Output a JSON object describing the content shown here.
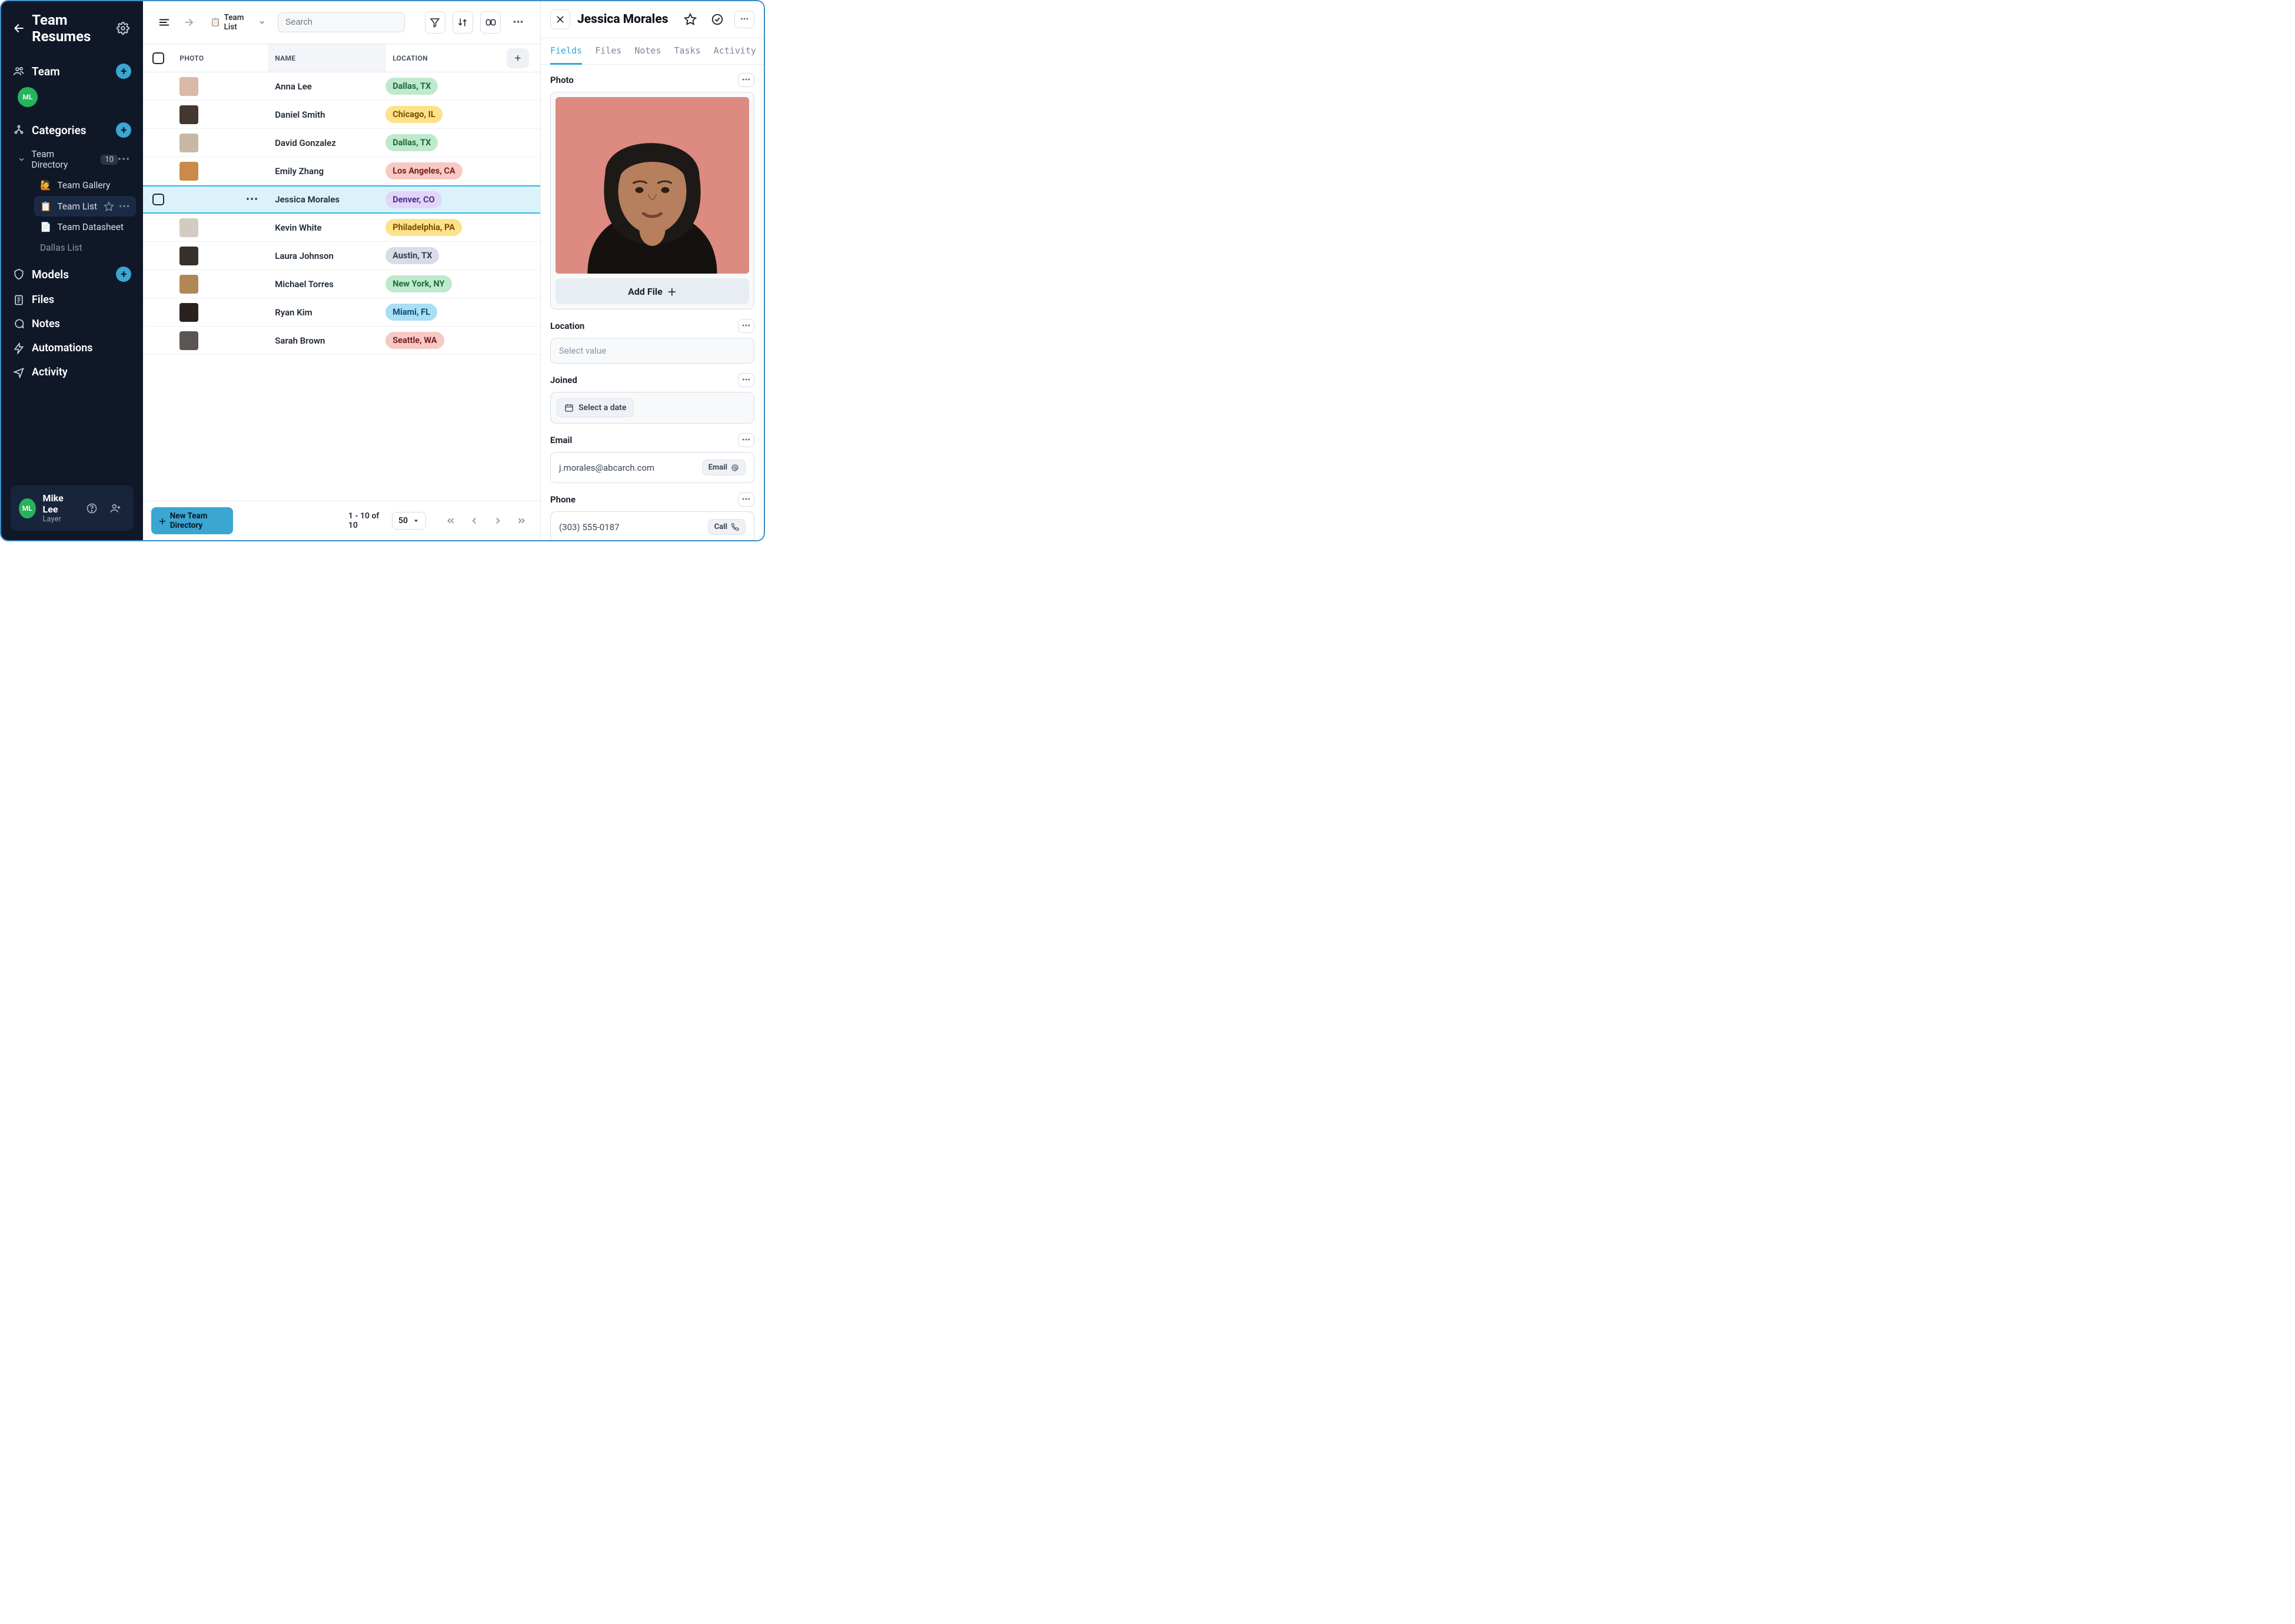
{
  "sidebar": {
    "title": "Team Resumes",
    "team_label": "Team",
    "team_avatar_initials": "ML",
    "team_avatar_color": "#26b35a",
    "categories_label": "Categories",
    "category": {
      "name": "Team Directory",
      "count": "10",
      "children": [
        {
          "icon": "🙋",
          "label": "Team Gallery",
          "active": false
        },
        {
          "icon": "📋",
          "label": "Team List",
          "active": true
        },
        {
          "icon": "📄",
          "label": "Team Datasheet",
          "active": false
        },
        {
          "icon": "",
          "label": "Dallas List",
          "active": false
        }
      ]
    },
    "models_label": "Models",
    "files_label": "Files",
    "notes_label": "Notes",
    "automations_label": "Automations",
    "activity_label": "Activity",
    "user": {
      "name": "Mike Lee",
      "sub": "Layer",
      "initials": "ML",
      "color": "#26b35a"
    }
  },
  "toolbar": {
    "breadcrumb_icon": "📋",
    "breadcrumb_label": "Team List",
    "search_placeholder": "Search"
  },
  "table": {
    "columns": {
      "photo": "PHOTO",
      "name": "NAME",
      "location": "LOCATION"
    },
    "rows": [
      {
        "name": "Anna Lee",
        "location": "Dallas, TX",
        "pill_bg": "#bfe9cc",
        "pill_fg": "#1f6b3a",
        "avatar": "#d9b9a7"
      },
      {
        "name": "Daniel Smith",
        "location": "Chicago, IL",
        "pill_bg": "#fde28a",
        "pill_fg": "#7a4d00",
        "avatar": "#45362f"
      },
      {
        "name": "David Gonzalez",
        "location": "Dallas, TX",
        "pill_bg": "#bfe9cc",
        "pill_fg": "#1f6b3a",
        "avatar": "#c7b7a5"
      },
      {
        "name": "Emily Zhang",
        "location": "Los Angeles, CA",
        "pill_bg": "#f7c9c4",
        "pill_fg": "#7a1f1f",
        "avatar": "#c98a4a"
      },
      {
        "name": "Jessica Morales",
        "location": "Denver, CO",
        "pill_bg": "#e1d5f8",
        "pill_fg": "#4b2f8e",
        "avatar": "",
        "selected": true
      },
      {
        "name": "Kevin White",
        "location": "Philadelphia, PA",
        "pill_bg": "#fde28a",
        "pill_fg": "#7a4d00",
        "avatar": "#d3cbbf"
      },
      {
        "name": "Laura Johnson",
        "location": "Austin, TX",
        "pill_bg": "#d7dde6",
        "pill_fg": "#30415a",
        "avatar": "#37302b"
      },
      {
        "name": "Michael Torres",
        "location": "New York, NY",
        "pill_bg": "#bfe9cc",
        "pill_fg": "#1f6b3a",
        "avatar": "#b08757"
      },
      {
        "name": "Ryan Kim",
        "location": "Miami, FL",
        "pill_bg": "#a9def4",
        "pill_fg": "#0b4f72",
        "avatar": "#2b221f"
      },
      {
        "name": "Sarah Brown",
        "location": "Seattle, WA",
        "pill_bg": "#f7c9c4",
        "pill_fg": "#7a1f1f",
        "avatar": "#5b5653"
      }
    ]
  },
  "footer": {
    "new_label": "New Team Directory",
    "pager_info": "1 - 10 of 10",
    "page_size": "50"
  },
  "detail": {
    "title": "Jessica Morales",
    "tabs": [
      "Fields",
      "Files",
      "Notes",
      "Tasks",
      "Activity"
    ],
    "active_tab": 0,
    "photo_label": "Photo",
    "add_file_label": "Add File",
    "location_label": "Location",
    "location_placeholder": "Select value",
    "joined_label": "Joined",
    "joined_placeholder": "Select a date",
    "email_label": "Email",
    "email_value": "j.morales@abcarch.com",
    "email_btn": "Email",
    "phone_label": "Phone",
    "phone_value": "(303) 555-0187",
    "phone_btn": "Call"
  }
}
